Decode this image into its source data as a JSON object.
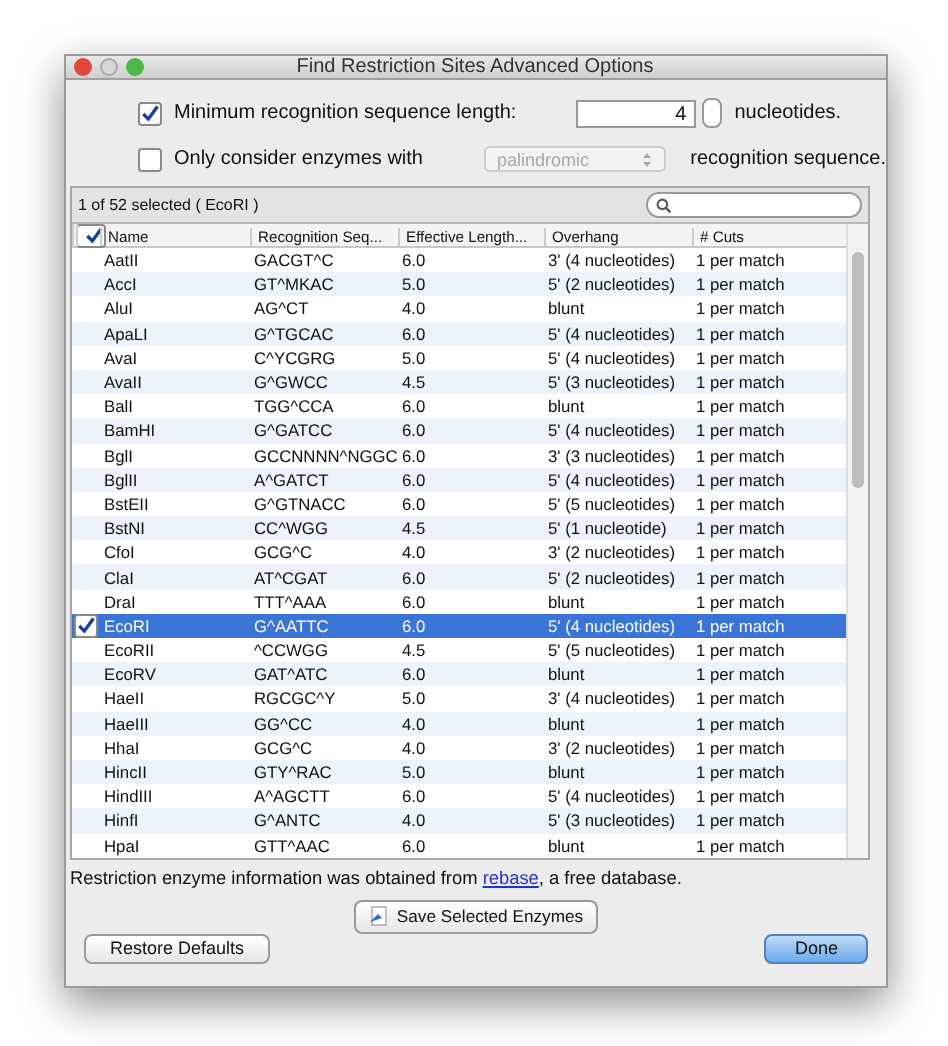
{
  "window": {
    "title": "Find Restriction Sites Advanced Options"
  },
  "min_length": {
    "checked": true,
    "label": "Minimum recognition sequence length:",
    "value": "4",
    "unit": "nucleotides."
  },
  "only_consider": {
    "checked": false,
    "label": "Only consider enzymes with",
    "dropdown": "palindromic",
    "dropdown_disabled": true,
    "suffix": "recognition sequence."
  },
  "table": {
    "status": "1 of 52 selected ( EcoRI )",
    "header_checked": true,
    "columns": [
      "Name",
      "Recognition Seq...",
      "Effective Length...",
      "Overhang",
      "# Cuts"
    ],
    "rows": [
      {
        "cells": [
          "AatII",
          "GACGT^C",
          "6.0",
          "3' (4 nucleotides)",
          "1 per match"
        ],
        "selected": false
      },
      {
        "cells": [
          "AccI",
          "GT^MKAC",
          "5.0",
          "5' (2 nucleotides)",
          "1 per match"
        ],
        "selected": false
      },
      {
        "cells": [
          "AluI",
          "AG^CT",
          "4.0",
          "blunt",
          "1 per match"
        ],
        "selected": false
      },
      {
        "cells": [
          "ApaLI",
          "G^TGCAC",
          "6.0",
          "5' (4 nucleotides)",
          "1 per match"
        ],
        "selected": false
      },
      {
        "cells": [
          "AvaI",
          "C^YCGRG",
          "5.0",
          "5' (4 nucleotides)",
          "1 per match"
        ],
        "selected": false
      },
      {
        "cells": [
          "AvaII",
          "G^GWCC",
          "4.5",
          "5' (3 nucleotides)",
          "1 per match"
        ],
        "selected": false
      },
      {
        "cells": [
          "BalI",
          "TGG^CCA",
          "6.0",
          "blunt",
          "1 per match"
        ],
        "selected": false
      },
      {
        "cells": [
          "BamHI",
          "G^GATCC",
          "6.0",
          "5' (4 nucleotides)",
          "1 per match"
        ],
        "selected": false
      },
      {
        "cells": [
          "BglI",
          "GCCNNNN^NGGC",
          "6.0",
          "3' (3 nucleotides)",
          "1 per match"
        ],
        "selected": false
      },
      {
        "cells": [
          "BglII",
          "A^GATCT",
          "6.0",
          "5' (4 nucleotides)",
          "1 per match"
        ],
        "selected": false
      },
      {
        "cells": [
          "BstEII",
          "G^GTNACC",
          "6.0",
          "5' (5 nucleotides)",
          "1 per match"
        ],
        "selected": false
      },
      {
        "cells": [
          "BstNI",
          "CC^WGG",
          "4.5",
          "5' (1 nucleotide)",
          "1 per match"
        ],
        "selected": false
      },
      {
        "cells": [
          "CfoI",
          "GCG^C",
          "4.0",
          "3' (2 nucleotides)",
          "1 per match"
        ],
        "selected": false
      },
      {
        "cells": [
          "ClaI",
          "AT^CGAT",
          "6.0",
          "5' (2 nucleotides)",
          "1 per match"
        ],
        "selected": false
      },
      {
        "cells": [
          "DraI",
          "TTT^AAA",
          "6.0",
          "blunt",
          "1 per match"
        ],
        "selected": false
      },
      {
        "cells": [
          "EcoRI",
          "G^AATTC",
          "6.0",
          "5' (4 nucleotides)",
          "1 per match"
        ],
        "selected": true
      },
      {
        "cells": [
          "EcoRII",
          "^CCWGG",
          "4.5",
          "5' (5 nucleotides)",
          "1 per match"
        ],
        "selected": false
      },
      {
        "cells": [
          "EcoRV",
          "GAT^ATC",
          "6.0",
          "blunt",
          "1 per match"
        ],
        "selected": false
      },
      {
        "cells": [
          "HaeII",
          "RGCGC^Y",
          "5.0",
          "3' (4 nucleotides)",
          "1 per match"
        ],
        "selected": false
      },
      {
        "cells": [
          "HaeIII",
          "GG^CC",
          "4.0",
          "blunt",
          "1 per match"
        ],
        "selected": false
      },
      {
        "cells": [
          "HhaI",
          "GCG^C",
          "4.0",
          "3' (2 nucleotides)",
          "1 per match"
        ],
        "selected": false
      },
      {
        "cells": [
          "HincII",
          "GTY^RAC",
          "5.0",
          "blunt",
          "1 per match"
        ],
        "selected": false
      },
      {
        "cells": [
          "HindIII",
          "A^AGCTT",
          "6.0",
          "5' (4 nucleotides)",
          "1 per match"
        ],
        "selected": false
      },
      {
        "cells": [
          "HinfI",
          "G^ANTC",
          "4.0",
          "5' (3 nucleotides)",
          "1 per match"
        ],
        "selected": false
      },
      {
        "cells": [
          "HpaI",
          "GTT^AAC",
          "6.0",
          "blunt",
          "1 per match"
        ],
        "selected": false
      }
    ]
  },
  "info": {
    "before": "Restriction enzyme information was obtained from ",
    "link": "rebase",
    "after": ", a free database."
  },
  "save_button": "Save Selected Enzymes",
  "buttons": [
    {
      "label": "Restore Defaults",
      "kind": "plain"
    },
    {
      "label": "Done",
      "kind": "default"
    }
  ]
}
